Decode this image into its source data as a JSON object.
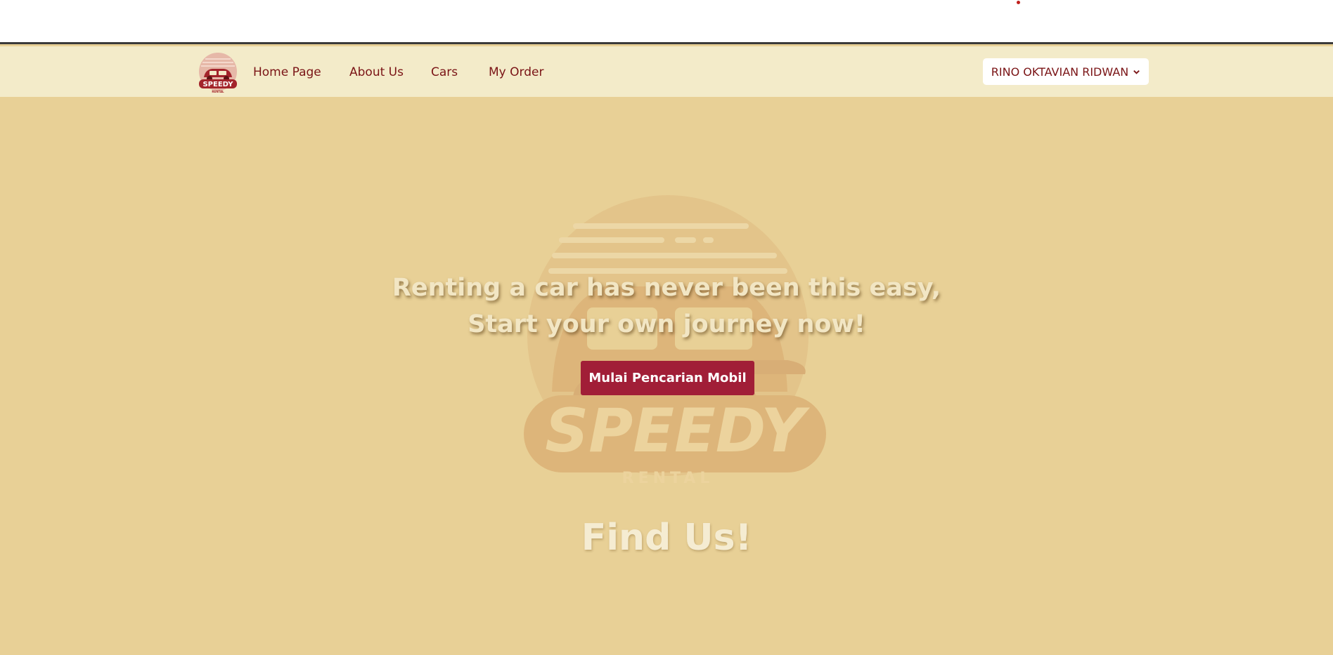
{
  "nav": {
    "links": [
      {
        "label": "Home Page"
      },
      {
        "label": "About Us"
      },
      {
        "label": "Cars"
      },
      {
        "label": "My Order"
      }
    ],
    "user_menu_label": "RINO OKTAVIAN RIDWAN",
    "user_menu_icon": "chevron-down-icon",
    "logo": {
      "word": "SPEEDY",
      "sub": "RENTAL"
    }
  },
  "hero": {
    "title_line1": "Renting a car has never been this easy,",
    "title_line2": "Start your own journey now!",
    "cta_label": "Mulai Pencarian Mobil",
    "watermark": {
      "word": "SPEEDY",
      "sub": "RENTAL"
    }
  },
  "section": {
    "find_us_title": "Find Us!"
  },
  "colors": {
    "accent": "#a11e37",
    "brand_text": "#7a1416",
    "navbar_bg": "#f3ebc9",
    "hero_bg": "#e8d096"
  }
}
